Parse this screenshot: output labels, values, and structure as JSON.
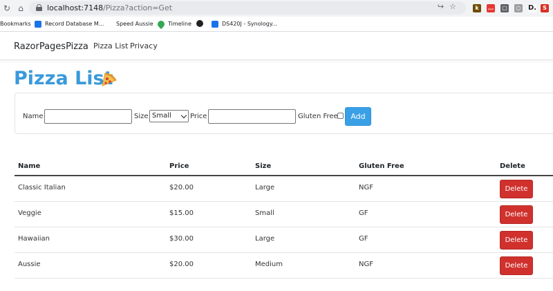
{
  "browser": {
    "url_host": "localhost:7148",
    "url_path": "/Pizza?action=Get",
    "bookmarks": [
      {
        "label": "Bookmarks",
        "icon": "",
        "color": ""
      },
      {
        "label": "Record Database M...",
        "icon": "database-icon",
        "color": "#1a73e8"
      },
      {
        "label": "Speed Aussie",
        "icon": "",
        "color": ""
      },
      {
        "label": "Timeline",
        "icon": "map-pin-icon",
        "color": "#34a853"
      },
      {
        "label": "",
        "icon": "globe-icon",
        "color": "#202124"
      },
      {
        "label": "DS420J - Synology...",
        "icon": "synology-icon",
        "color": "#1a73e8"
      }
    ],
    "extensions": [
      {
        "label": "k",
        "color": "#6d4c00"
      },
      {
        "label": "…",
        "color": "#e53935"
      },
      {
        "label": "▢",
        "color": "#5f6368"
      },
      {
        "label": "○",
        "color": "#9e9e9e"
      },
      {
        "label": "D.",
        "color": "#202124"
      },
      {
        "label": "S",
        "color": "#d93025"
      }
    ]
  },
  "navbar": {
    "brand": "RazorPagesPizza",
    "links": [
      "Pizza List",
      "Privacy"
    ]
  },
  "page": {
    "title": "Pizza List",
    "title_color": "#3a9ad9"
  },
  "form": {
    "name_label": "Name",
    "name_value": "",
    "size_label": "Size",
    "size_selected": "Small",
    "price_label": "Price",
    "price_value": "",
    "gluten_label": "Gluten Free",
    "gluten_checked": false,
    "add_label": "Add"
  },
  "table": {
    "headers": [
      "Name",
      "Price",
      "Size",
      "Gluten Free",
      "Delete"
    ],
    "rows": [
      {
        "name": "Classic Italian",
        "price": "$20.00",
        "size": "Large",
        "gluten": "NGF",
        "action": "Delete"
      },
      {
        "name": "Veggie",
        "price": "$15.00",
        "size": "Small",
        "gluten": "GF",
        "action": "Delete"
      },
      {
        "name": "Hawaiian",
        "price": "$30.00",
        "size": "Large",
        "gluten": "GF",
        "action": "Delete"
      },
      {
        "name": "Aussie",
        "price": "$20.00",
        "size": "Medium",
        "gluten": "NGF",
        "action": "Delete"
      }
    ]
  },
  "colors": {
    "accent": "#3aa0e6",
    "danger": "#d0312d"
  }
}
